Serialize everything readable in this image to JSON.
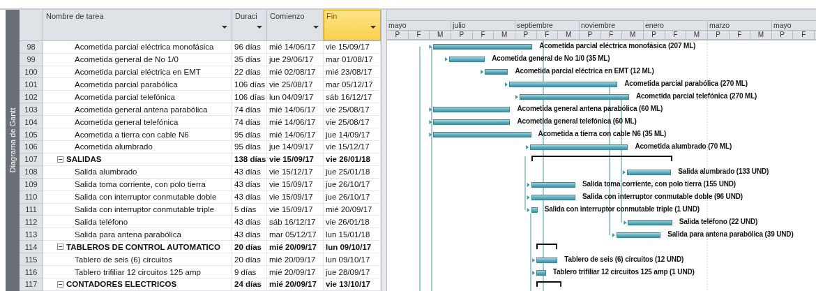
{
  "side_tab": {
    "label": "Diagrama de Gantt"
  },
  "columns": [
    {
      "label": "Nombre de tarea",
      "selected": false
    },
    {
      "label": "Duraci",
      "selected": false
    },
    {
      "label": "Comienzo",
      "selected": false
    },
    {
      "label": "Fin",
      "selected": true
    }
  ],
  "timescale": {
    "major": [
      "mayo",
      "julio",
      "septiembre",
      "noviembre",
      "enero",
      "marzo",
      "mayo"
    ],
    "minor": [
      "P",
      "F",
      "M",
      "P",
      "F",
      "M",
      "P",
      "F",
      "M",
      "P",
      "F",
      "M",
      "P",
      "F",
      "M",
      "P",
      "F",
      "M",
      "P",
      "F"
    ]
  },
  "tasks": [
    {
      "id": "98",
      "kind": "task",
      "name": "Acometida parcial eléctrica monofásica",
      "duration": "96 días",
      "start": "mié 14/06/17",
      "end": "vie 15/09/17",
      "bar_label": "Acometida parcial eléctrica monofásica (207 ML)"
    },
    {
      "id": "99",
      "kind": "task",
      "name": "Acometida general de No 1/0",
      "duration": "35 días",
      "start": "jue 29/06/17",
      "end": "mar 01/08/17",
      "bar_label": "Acometida general de No 1/0 (35 ML)"
    },
    {
      "id": "100",
      "kind": "task",
      "name": "Acometida parcial eléctrica en EMT",
      "duration": "22 días",
      "start": "mié 02/08/17",
      "end": "mié 23/08/17",
      "bar_label": "Acometida parcial eléctrica en EMT (12 ML)"
    },
    {
      "id": "101",
      "kind": "task",
      "name": "Acometida parcial parabólica",
      "duration": "106 días",
      "start": "vie 25/08/17",
      "end": "mar 05/12/17",
      "bar_label": "Acometida parcial parabólica (270 ML)"
    },
    {
      "id": "102",
      "kind": "task",
      "name": "Acometida parcial telefónica",
      "duration": "106 días",
      "start": "lun 04/09/17",
      "end": "sáb 16/12/17",
      "bar_label": "Acometida parcial telefónica (270 ML)"
    },
    {
      "id": "103",
      "kind": "task",
      "name": "Acometida general antena parabólica",
      "duration": "74 días",
      "start": "mié 14/06/17",
      "end": "vie 25/08/17",
      "bar_label": "Acometida general antena parabólica (60 ML)"
    },
    {
      "id": "104",
      "kind": "task",
      "name": "Acometida general telefónica",
      "duration": "74 días",
      "start": "mié 14/06/17",
      "end": "vie 25/08/17",
      "bar_label": "Acometida general telefónica (60 ML)"
    },
    {
      "id": "105",
      "kind": "task",
      "name": "Acometida a tierra con cable N6",
      "duration": "95 días",
      "start": "mié 14/06/17",
      "end": "jue 14/09/17",
      "bar_label": "Acometida a tierra con cable N6 (35 ML)"
    },
    {
      "id": "106",
      "kind": "task",
      "name": "Acometida alumbrado",
      "duration": "95 días",
      "start": "jue 14/09/17",
      "end": "vie 15/12/17",
      "bar_label": "Acometida alumbrado (70 ML)"
    },
    {
      "id": "107",
      "kind": "summary",
      "expanded": true,
      "name": "SALIDAS",
      "duration": "138 días",
      "start": "vie 15/09/17",
      "end": "vie 26/01/18",
      "children": [
        {
          "id": "108",
          "kind": "task",
          "name": "Salida alumbrado",
          "duration": "43 días",
          "start": "vie 15/12/17",
          "end": "jue 25/01/18",
          "bar_label": "Salida alumbrado (133 UND)"
        },
        {
          "id": "109",
          "kind": "task",
          "name": "Salida toma corriente, con polo tierra",
          "duration": "43 días",
          "start": "vie 15/09/17",
          "end": "jue 26/10/17",
          "bar_label": "Salida toma corriente, con polo tierra (155 UND)"
        },
        {
          "id": "110",
          "kind": "task",
          "name": "Salida con interruptor conmutable doble",
          "duration": "43 días",
          "start": "vie 15/09/17",
          "end": "jue 26/10/17",
          "bar_label": "Salida con interruptor conmutable doble (96 UND)"
        },
        {
          "id": "111",
          "kind": "task",
          "name": "Salida con interruptor conmutable triple",
          "duration": "5 días",
          "start": "vie 15/09/17",
          "end": "mié 20/09/17",
          "bar_label": "Salida con interruptor conmutable triple (1 UND)"
        },
        {
          "id": "112",
          "kind": "task",
          "name": "Salida teléfono",
          "duration": "43 días",
          "start": "sáb 16/12/17",
          "end": "vie 26/01/18",
          "bar_label": "Salida teléfono (22 UND)"
        },
        {
          "id": "113",
          "kind": "task",
          "name": "Salida para antena parabólica",
          "duration": "43 días",
          "start": "mar 05/12/17",
          "end": "lun 15/01/18",
          "bar_label": "Salida para antena parabólica (39 UND)"
        }
      ]
    },
    {
      "id": "114",
      "kind": "summary",
      "expanded": true,
      "name": "TABLEROS DE CONTROL AUTOMATICO",
      "duration": "20 días",
      "start": "mié 20/09/17",
      "end": "lun 09/10/17",
      "children": [
        {
          "id": "115",
          "kind": "task",
          "name": "Tablero de seis (6) circuitos",
          "duration": "20 días",
          "start": "mié 20/09/17",
          "end": "lun 09/10/17",
          "bar_label": "Tablero de seis (6) circuitos (12 UND)"
        },
        {
          "id": "116",
          "kind": "task",
          "name": "Tablero trifiliar 12 circuitos 125 amp",
          "duration": "9 días",
          "start": "mié 20/09/17",
          "end": "jue 28/09/17",
          "bar_label": "Tablero trifiliar 12 circuitos 125 amp (1 UND)"
        }
      ]
    },
    {
      "id": "117",
      "kind": "summary",
      "expanded": true,
      "name": "CONTADORES ELECTRICOS",
      "duration": "24 días",
      "start": "mié 20/09/17",
      "end": "vie 13/10/17"
    }
  ]
}
